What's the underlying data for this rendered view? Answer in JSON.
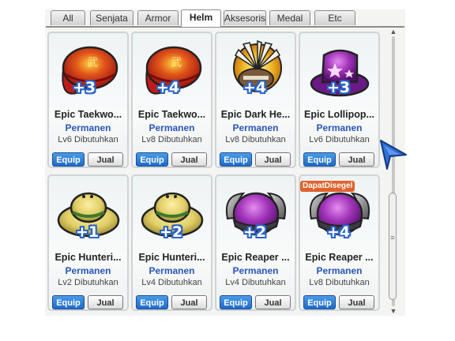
{
  "tabs": [
    {
      "label": "All",
      "active": false
    },
    {
      "label": "Senjata",
      "active": false
    },
    {
      "label": "Armor",
      "active": false
    },
    {
      "label": "Helm",
      "active": true
    },
    {
      "label": "Aksesoris",
      "active": false
    },
    {
      "label": "Medal",
      "active": false
    },
    {
      "label": "Etc",
      "active": false
    }
  ],
  "items": [
    {
      "name": "Epic Taekwo...",
      "duration": "Permanen",
      "requirement": "Lv6 Dibutuhkan",
      "enhance": "+3",
      "icon": "red-headband-icon",
      "equip_label": "Equip",
      "sell_label": "Jual"
    },
    {
      "name": "Epic Taekwo...",
      "duration": "Permanen",
      "requirement": "Lv8 Dibutuhkan",
      "enhance": "+4",
      "icon": "red-headband-icon",
      "equip_label": "Equip",
      "sell_label": "Jual"
    },
    {
      "name": "Epic Dark He...",
      "duration": "Permanen",
      "requirement": "Lv8 Dibutuhkan",
      "enhance": "+4",
      "icon": "feather-headdress-icon",
      "equip_label": "Equip",
      "sell_label": "Jual"
    },
    {
      "name": "Epic Lollipop...",
      "duration": "Permanen",
      "requirement": "Lv6 Dibutuhkan",
      "enhance": "+3",
      "icon": "purple-star-hat-icon",
      "equip_label": "Equip",
      "sell_label": "Jual"
    },
    {
      "name": "Epic Hunteri...",
      "duration": "Permanen",
      "requirement": "Lv2 Dibutuhkan",
      "enhance": "+1",
      "icon": "straw-hat-icon",
      "equip_label": "Equip",
      "sell_label": "Jual"
    },
    {
      "name": "Epic Hunteri...",
      "duration": "Permanen",
      "requirement": "Lv4 Dibutuhkan",
      "enhance": "+2",
      "icon": "straw-hat-icon",
      "equip_label": "Equip",
      "sell_label": "Jual"
    },
    {
      "name": "Epic Reaper ...",
      "duration": "Permanen",
      "requirement": "Lv4 Dibutuhkan",
      "enhance": "+2",
      "icon": "horned-helmet-icon",
      "equip_label": "Equip",
      "sell_label": "Jual"
    },
    {
      "name": "Epic Reaper ...",
      "duration": "Permanen",
      "requirement": "Lv8 Dibutuhkan",
      "enhance": "+4",
      "icon": "horned-helmet-icon",
      "equip_label": "Equip",
      "sell_label": "Jual"
    }
  ],
  "badge": {
    "label": "DapatDisegel"
  },
  "colors": {
    "equip": "#1e6acb",
    "permanen": "#2a55b8",
    "badge": "#e0622d",
    "enhance_outline": "#2a63c6"
  }
}
